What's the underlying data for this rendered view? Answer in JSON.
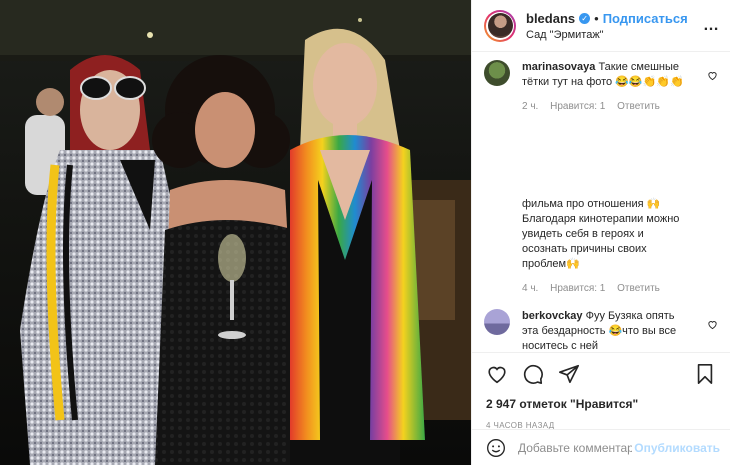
{
  "header": {
    "username": "bledans",
    "dot": "•",
    "follow_label": "Подписаться",
    "location": "Сад \"Эрмитаж\""
  },
  "comments": [
    {
      "username": "marinasovaya",
      "text": "Такие смешные тётки тут на фото 😂😂👏👏👏",
      "time": "2 ч.",
      "likes": "Нравится: 1",
      "reply": "Ответить"
    },
    {
      "username": "",
      "text": "фильма про отношения 🙌 Благодаря кинотерапии можно увидеть себя в героях и осознать причины своих проблем🙌",
      "time": "4 ч.",
      "likes": "Нравится: 1",
      "reply": "Ответить"
    },
    {
      "username": "berkovckay",
      "text": "Фуу Бузяка опять эта бездарность 😂что вы все носитесь с ней",
      "time": "",
      "likes": "",
      "reply": ""
    }
  ],
  "footer": {
    "likes_text": "2 947 отметок \"Нравится\"",
    "time_ago": "4 ЧАСОВ НАЗАД",
    "comment_placeholder": "Добавьте комментарий...",
    "publish_label": "Опубликовать"
  },
  "icons": {
    "like": "heart-icon",
    "comment": "comment-icon",
    "share": "share-icon",
    "save": "bookmark-icon",
    "options": "more-icon",
    "emoji": "emoji-icon"
  },
  "colors": {
    "accent": "#3897f0",
    "muted": "#8e8e8e",
    "text": "#262626",
    "publish_disabled": "#b3dbff"
  }
}
